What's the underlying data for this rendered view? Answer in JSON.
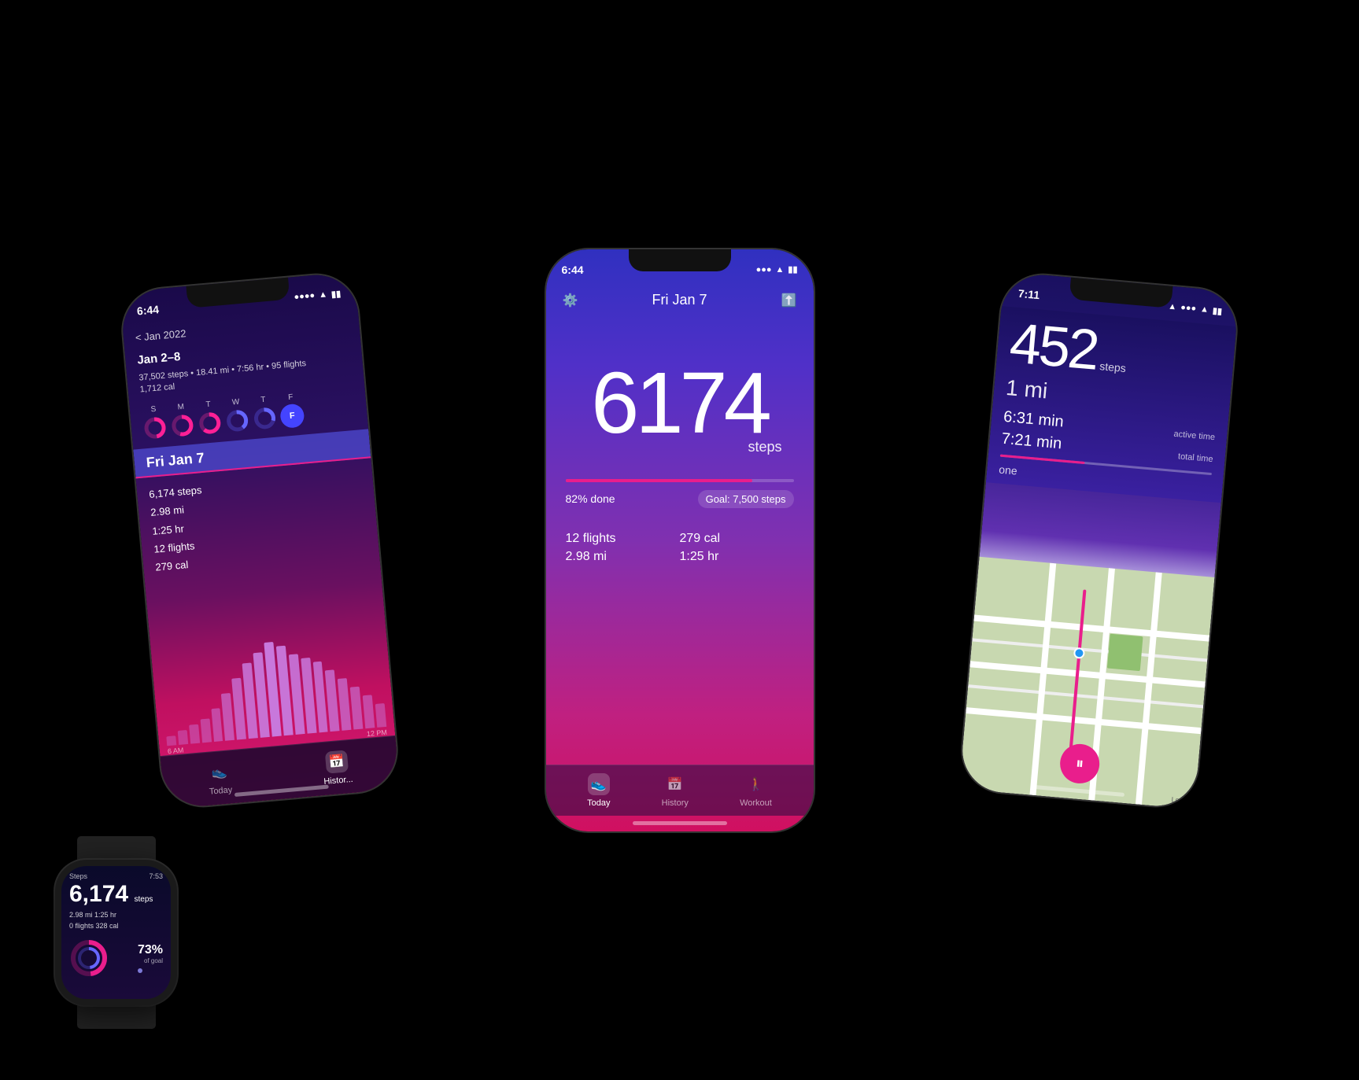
{
  "scene": {
    "bg": "#000000"
  },
  "center_phone": {
    "status_bar": {
      "time": "6:44",
      "icons": "●●● ▲ ▮▮"
    },
    "header": {
      "date": "Fri Jan 7",
      "gear_icon": "⚙",
      "share_icon": "⬆"
    },
    "steps": {
      "number": "6174",
      "unit": "steps"
    },
    "progress": {
      "pct": "82% done",
      "goal": "Goal: 7,500 steps",
      "fill": 82
    },
    "stats": {
      "flights": "12 flights",
      "calories": "279 cal",
      "distance": "2.98 mi",
      "time": "1:25 hr"
    },
    "tab_bar": {
      "today": "Today",
      "history": "History",
      "workout": "Workout"
    }
  },
  "left_phone": {
    "status_bar": {
      "time": "6:44"
    },
    "nav": "< Jan 2022",
    "week": {
      "range": "Jan 2–8",
      "stats": "37,502 steps • 18.41 mi • 7:56 hr • 95 flights",
      "calories": "1,712 cal"
    },
    "days": [
      "S",
      "M",
      "T",
      "W",
      "T",
      "F"
    ],
    "date_banner": "Fri Jan 7",
    "day_stats": {
      "steps": "6,174 steps",
      "distance": "2.98 mi",
      "time": "1:25 hr",
      "flights": "12 flights",
      "calories": "279 cal"
    },
    "chart_labels": {
      "left": "6 AM",
      "right": "12 PM"
    },
    "chart_bars": [
      10,
      15,
      20,
      25,
      35,
      50,
      65,
      80,
      90,
      100,
      95,
      85,
      80,
      75,
      65,
      55,
      45,
      35,
      25
    ],
    "tab_bar": {
      "today": "Today",
      "history": "Histor..."
    }
  },
  "right_phone": {
    "status_bar": {
      "time": "7:11",
      "arrow": "↑"
    },
    "steps": "452",
    "steps_unit": "steps",
    "distance": "1 mi",
    "active_time": {
      "value": "6:31 min",
      "label": "active time"
    },
    "total_time": {
      "value": "7:21 min",
      "label": "total time"
    },
    "zone_label": "one",
    "map": {
      "legal": "Legal"
    }
  },
  "watch": {
    "label": "Steps",
    "time": "7:53",
    "steps": "6,174",
    "steps_unit": "steps",
    "row1": "2.98 mi     1:25 hr",
    "row2": "0 flights    328 cal",
    "pct": "73%",
    "pct_label": "of goal"
  }
}
